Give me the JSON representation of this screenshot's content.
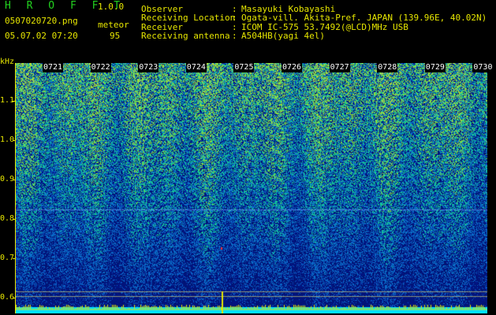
{
  "app": {
    "name": "H R O F F T",
    "version": "1.0.0"
  },
  "file": {
    "name": "0507020720.png",
    "datetime": "05.07.02 07:20"
  },
  "detection": {
    "label": "meteor",
    "count": "95"
  },
  "info": {
    "observer_key": "Observer",
    "observer_val": "Masayuki Kobayashi",
    "location_key": "Receiving Location",
    "location_val": "Ogata-vill. Akita-Pref. JAPAN (139.96E, 40.02N)",
    "receiver_key": "Receiver",
    "receiver_val": "ICOM IC-575 53.7492(@LCD)MHz USB",
    "antenna_key": "Receiving antenna",
    "antenna_val": "A504HB(yagi 4el)"
  },
  "spectrogram": {
    "y_unit": "kHz",
    "y_ticks": [
      "1.1",
      "1.0",
      "0.9",
      "0.8",
      "0.7",
      "0.6"
    ],
    "x_ticks": [
      "0721",
      "0722",
      "0723",
      "0724",
      "0725",
      "0726",
      "0727",
      "0728",
      "0729",
      "0730"
    ],
    "colors": {
      "background": "#000000",
      "text_primary": "#e6e600",
      "text_secondary": "#22d11f",
      "noise_low": "#031a8a",
      "noise_high": "#22d11f",
      "baseline": "#00e0ff"
    }
  }
}
